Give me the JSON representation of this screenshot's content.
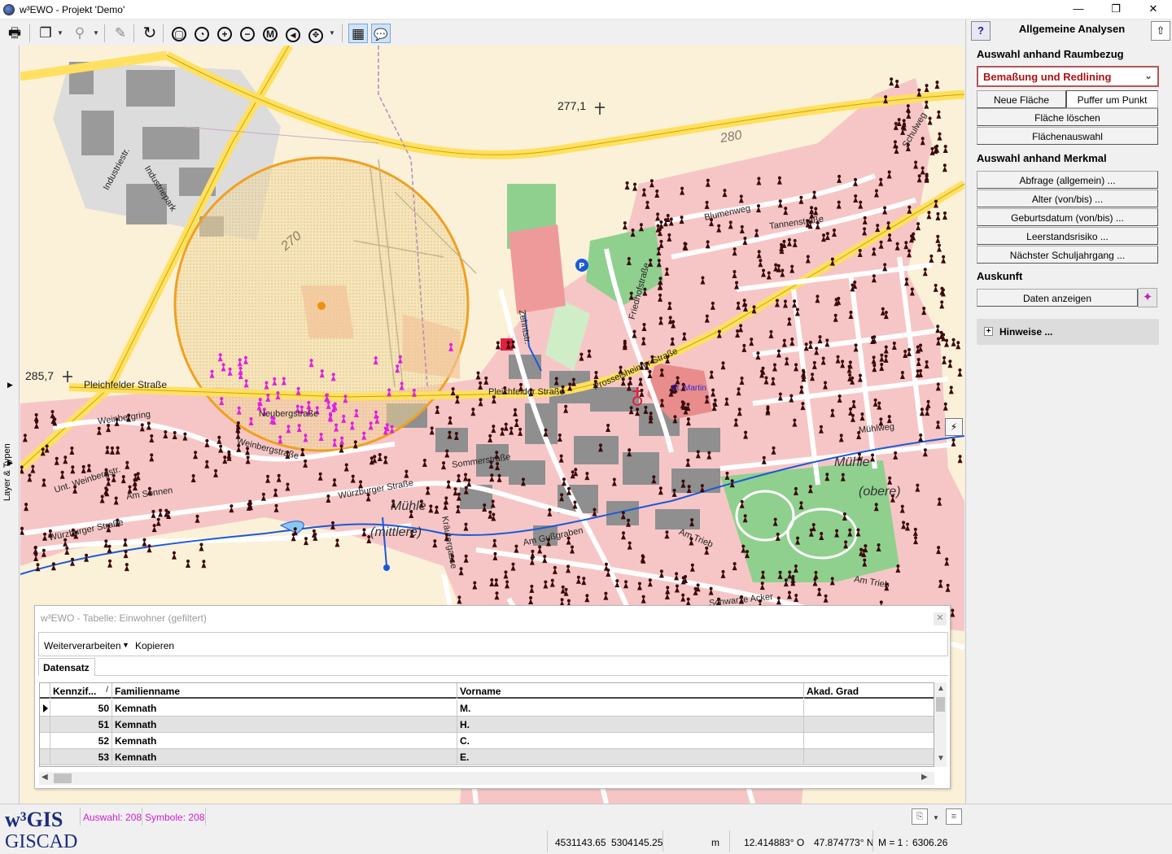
{
  "window": {
    "title": "w³EWO - Projekt 'Demo'",
    "controls": {
      "minimize": "—",
      "restore": "❐",
      "close": "✕"
    }
  },
  "toolbar": {
    "tools": [
      {
        "name": "print-icon",
        "glyph": "🖶"
      },
      {
        "name": "copy-icon",
        "glyph": "❐"
      },
      {
        "name": "zoom-lens-icon",
        "glyph": "⚲"
      },
      {
        "name": "edit-pen-icon",
        "glyph": "✎"
      },
      {
        "name": "refresh-icon",
        "glyph": "↻"
      },
      {
        "name": "zoom-full-icon",
        "glyph": "▢"
      },
      {
        "name": "zoom-previous-icon",
        "glyph": "◔"
      },
      {
        "name": "zoom-in-icon",
        "glyph": "+"
      },
      {
        "name": "zoom-out-icon",
        "glyph": "−"
      },
      {
        "name": "zoom-m-icon",
        "glyph": "M"
      },
      {
        "name": "back-icon",
        "glyph": "◀"
      },
      {
        "name": "pan-icon",
        "glyph": "✥"
      },
      {
        "name": "table-icon",
        "glyph": "▦"
      },
      {
        "name": "speech-bubble-icon",
        "glyph": "💬"
      }
    ]
  },
  "left_strip": {
    "label": "Layer & Typen",
    "arrow": "▶"
  },
  "map": {
    "labels": {
      "elev_2771": "277,1",
      "elev_2857": "285,7",
      "contour_280": "280",
      "contour_270": "270",
      "industriestr": "Industriestr.",
      "industriepark": "Industriepark",
      "pleichfelder": "Pleichfelder Straße",
      "pleichfelder2": "Pleichfelder Straße",
      "neubergstr": "Neubergstraße",
      "weinbergring": "Weinbergring",
      "weinbergstrasse": "Weinbergstraße",
      "wuerzburger1": "Würzburger Straße",
      "wuerzburger2": "Würzburger Straße",
      "muehle_mittlere": "Mühle",
      "mittlere": "(mittlere)",
      "muehle_obere": "Mühle",
      "obere": "(obere)",
      "prosselsheimer": "Prosselsheimer Straße",
      "friedhofstr": "Friedhofstraße",
      "blumenweg": "Blumenweg",
      "tannenstr": "Tannenstraße",
      "stmartin": "St. Martin",
      "sommersstr": "Sommerstraße",
      "am_guesgraben": "Am Gußgraben",
      "am_trieb1": "Am Trieb",
      "am_trieb2": "Am Trieb",
      "schwarze_acker": "Schwarze Acker",
      "muehlweg": "Mühlweg",
      "kraeutergasse": "Kräutergasse",
      "am_sonnen": "Am Sonnen",
      "untere_weinberg": "Unt. Weinbergstr.",
      "schulweg": "Schulweg",
      "zehntstr": "Zehntstr."
    },
    "buffer_circle_color": "#f0a020",
    "selection_color": "#e020e0"
  },
  "table_window": {
    "title": "w³EWO - Tabelle: Einwohner (gefiltert)",
    "close": "✕",
    "menu": {
      "weiterverarbeiten": "Weiterverarbeiten",
      "kopieren": "Kopieren"
    },
    "tab": "Datensatz",
    "columns": [
      "Kennzif...",
      "Familienname",
      "Vorname",
      "Akad. Grad"
    ],
    "sort_indicator": "/",
    "rows": [
      {
        "kennziffer": "50",
        "familienname": "Kemnath",
        "vorname": "M.",
        "akad": ""
      },
      {
        "kennziffer": "51",
        "familienname": "Kemnath",
        "vorname": "H.",
        "akad": ""
      },
      {
        "kennziffer": "52",
        "familienname": "Kemnath",
        "vorname": "C.",
        "akad": ""
      },
      {
        "kennziffer": "53",
        "familienname": "Kemnath",
        "vorname": "E.",
        "akad": ""
      }
    ]
  },
  "panel": {
    "help": "?",
    "title": "Allgemeine Analysen",
    "pin": "⇧",
    "section_raum": "Auswahl anhand Raumbezug",
    "select_value": "Bemaßung und Redlining",
    "btn_neue_flaeche": "Neue Fläche",
    "btn_puffer": "Puffer um Punkt",
    "btn_flaeche_loeschen": "Fläche löschen",
    "btn_flaechenauswahl": "Flächenauswahl",
    "section_merkmal": "Auswahl anhand Merkmal",
    "btn_abfrage": "Abfrage (allgemein) ...",
    "btn_alter": "Alter (von/bis) ...",
    "btn_geburtsdatum": "Geburtsdatum (von/bis) ...",
    "btn_leerstand": "Leerstandsrisiko ...",
    "btn_schuljahrgang": "Nächster Schuljahrgang ...",
    "section_auskunft": "Auskunft",
    "btn_daten": "Daten anzeigen",
    "hinweise": "Hinweise ...",
    "plus": "+"
  },
  "status": {
    "logo_w3gis": "w³GIS",
    "logo_giscad": "GISCAD",
    "auswahl": "Auswahl: 208",
    "symbole": "Symbole: 208",
    "coord_x": "4531143.65",
    "coord_y": "5304145.25",
    "unit": "m",
    "lon": "12.414883° O",
    "lat": "47.874773° N",
    "scale_label": "M = 1 :",
    "scale_value": "6306.26"
  }
}
